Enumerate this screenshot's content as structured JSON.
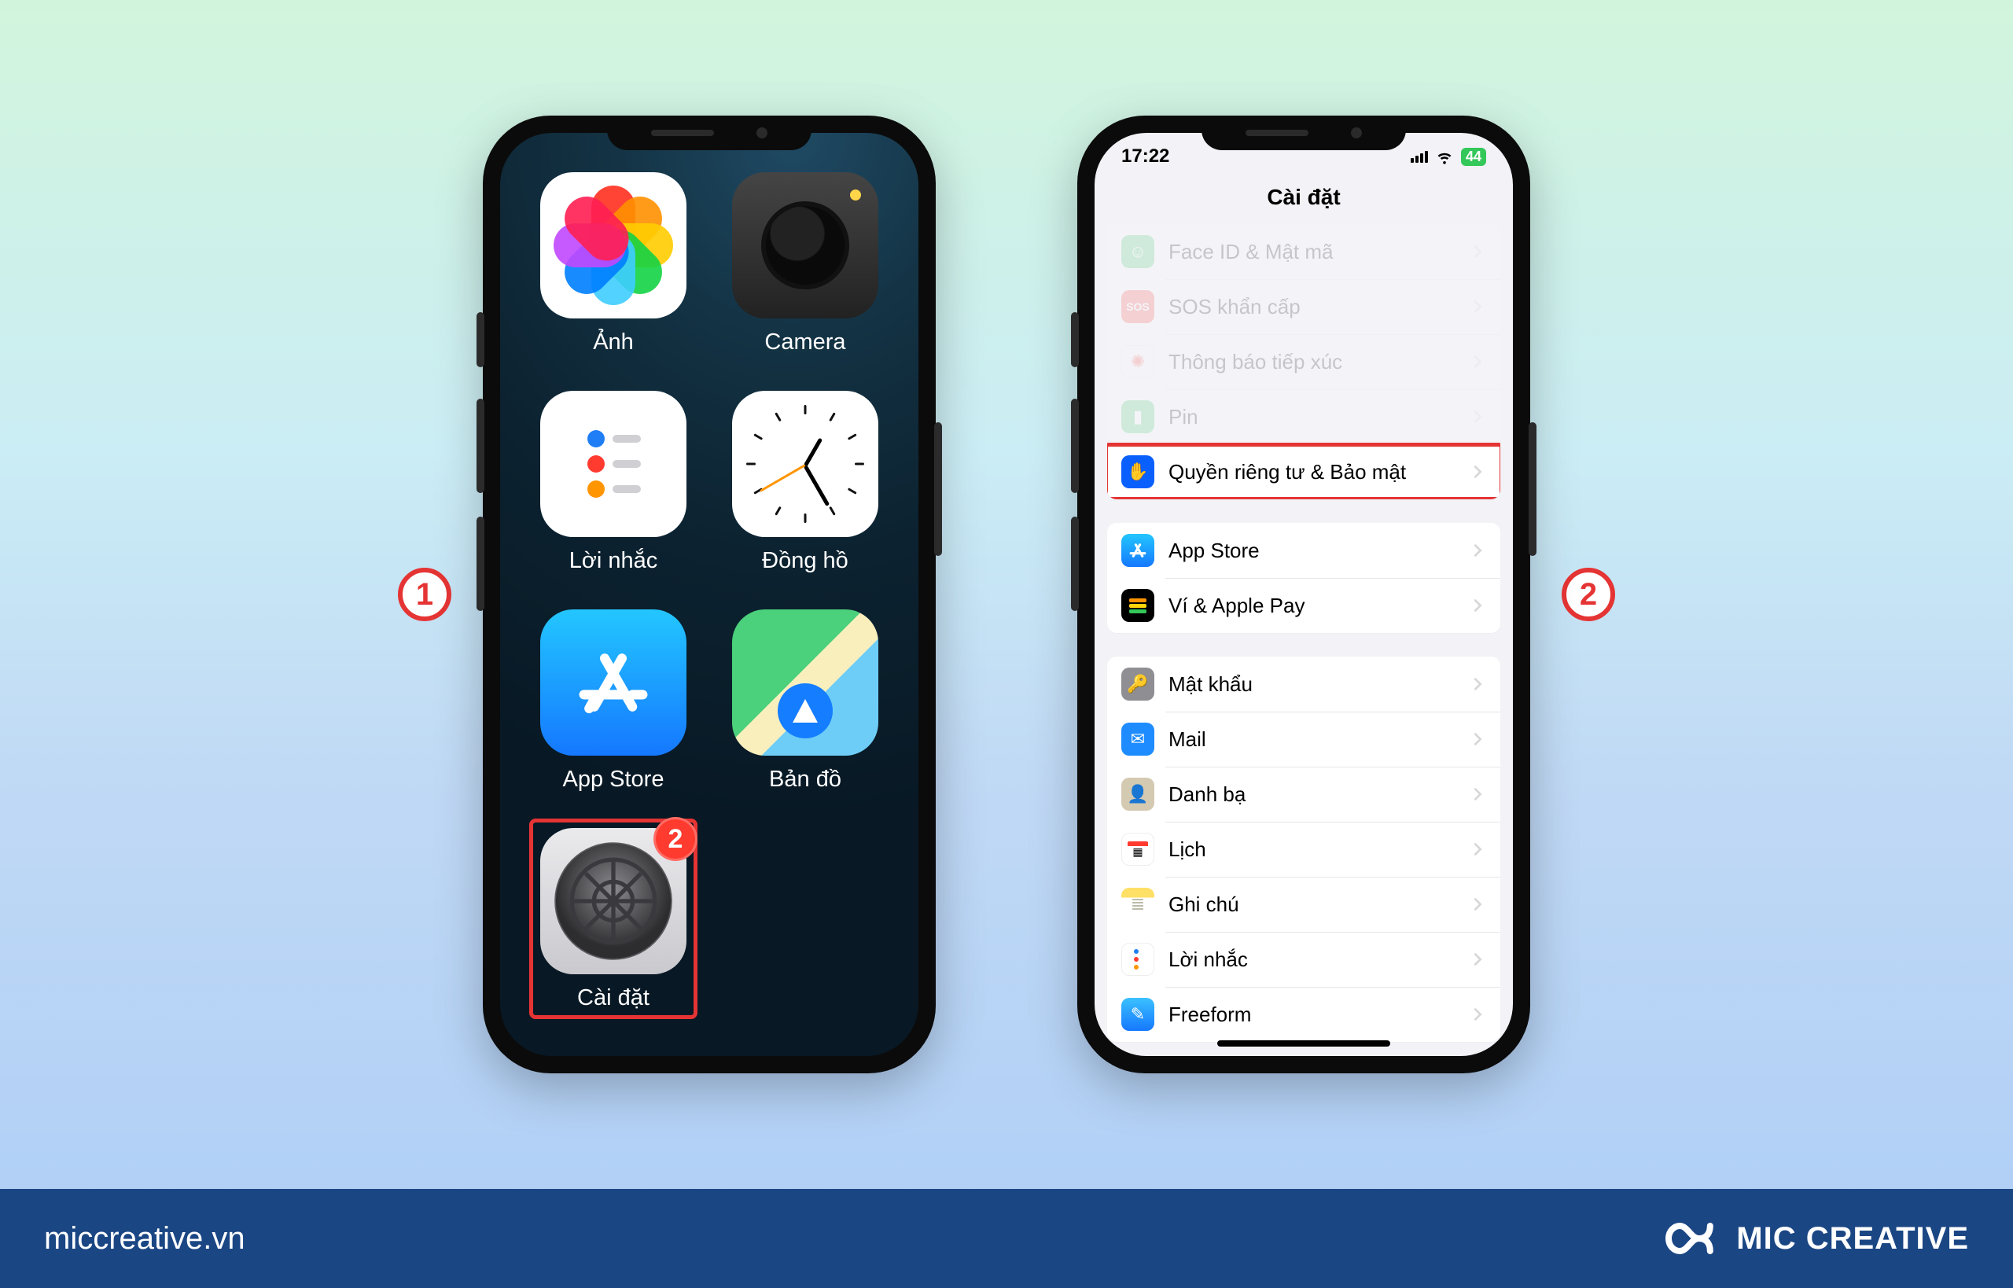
{
  "steps": {
    "one": "1",
    "two": "2"
  },
  "home": {
    "apps": {
      "photos": "Ảnh",
      "camera": "Camera",
      "reminders": "Lời nhắc",
      "clock": "Đồng hồ",
      "appstore": "App Store",
      "maps": "Bản đồ",
      "settings": "Cài đặt"
    },
    "settings_badge": "2"
  },
  "settings": {
    "status": {
      "time": "17:22",
      "battery": "44"
    },
    "title": "Cài đặt",
    "group1": {
      "faceid": "Face ID & Mật mã",
      "sos": "SOS khẩn cấp",
      "exposure": "Thông báo tiếp xúc",
      "battery": "Pin",
      "privacy": "Quyền riêng tư & Bảo mật"
    },
    "group2": {
      "appstore": "App Store",
      "wallet": "Ví & Apple Pay"
    },
    "group3": {
      "passwords": "Mật khẩu",
      "mail": "Mail",
      "contacts": "Danh bạ",
      "calendar": "Lịch",
      "notes": "Ghi chú",
      "reminders": "Lời nhắc",
      "freeform": "Freeform"
    }
  },
  "footer": {
    "url": "miccreative.vn",
    "brand": "MIC CREATIVE"
  }
}
